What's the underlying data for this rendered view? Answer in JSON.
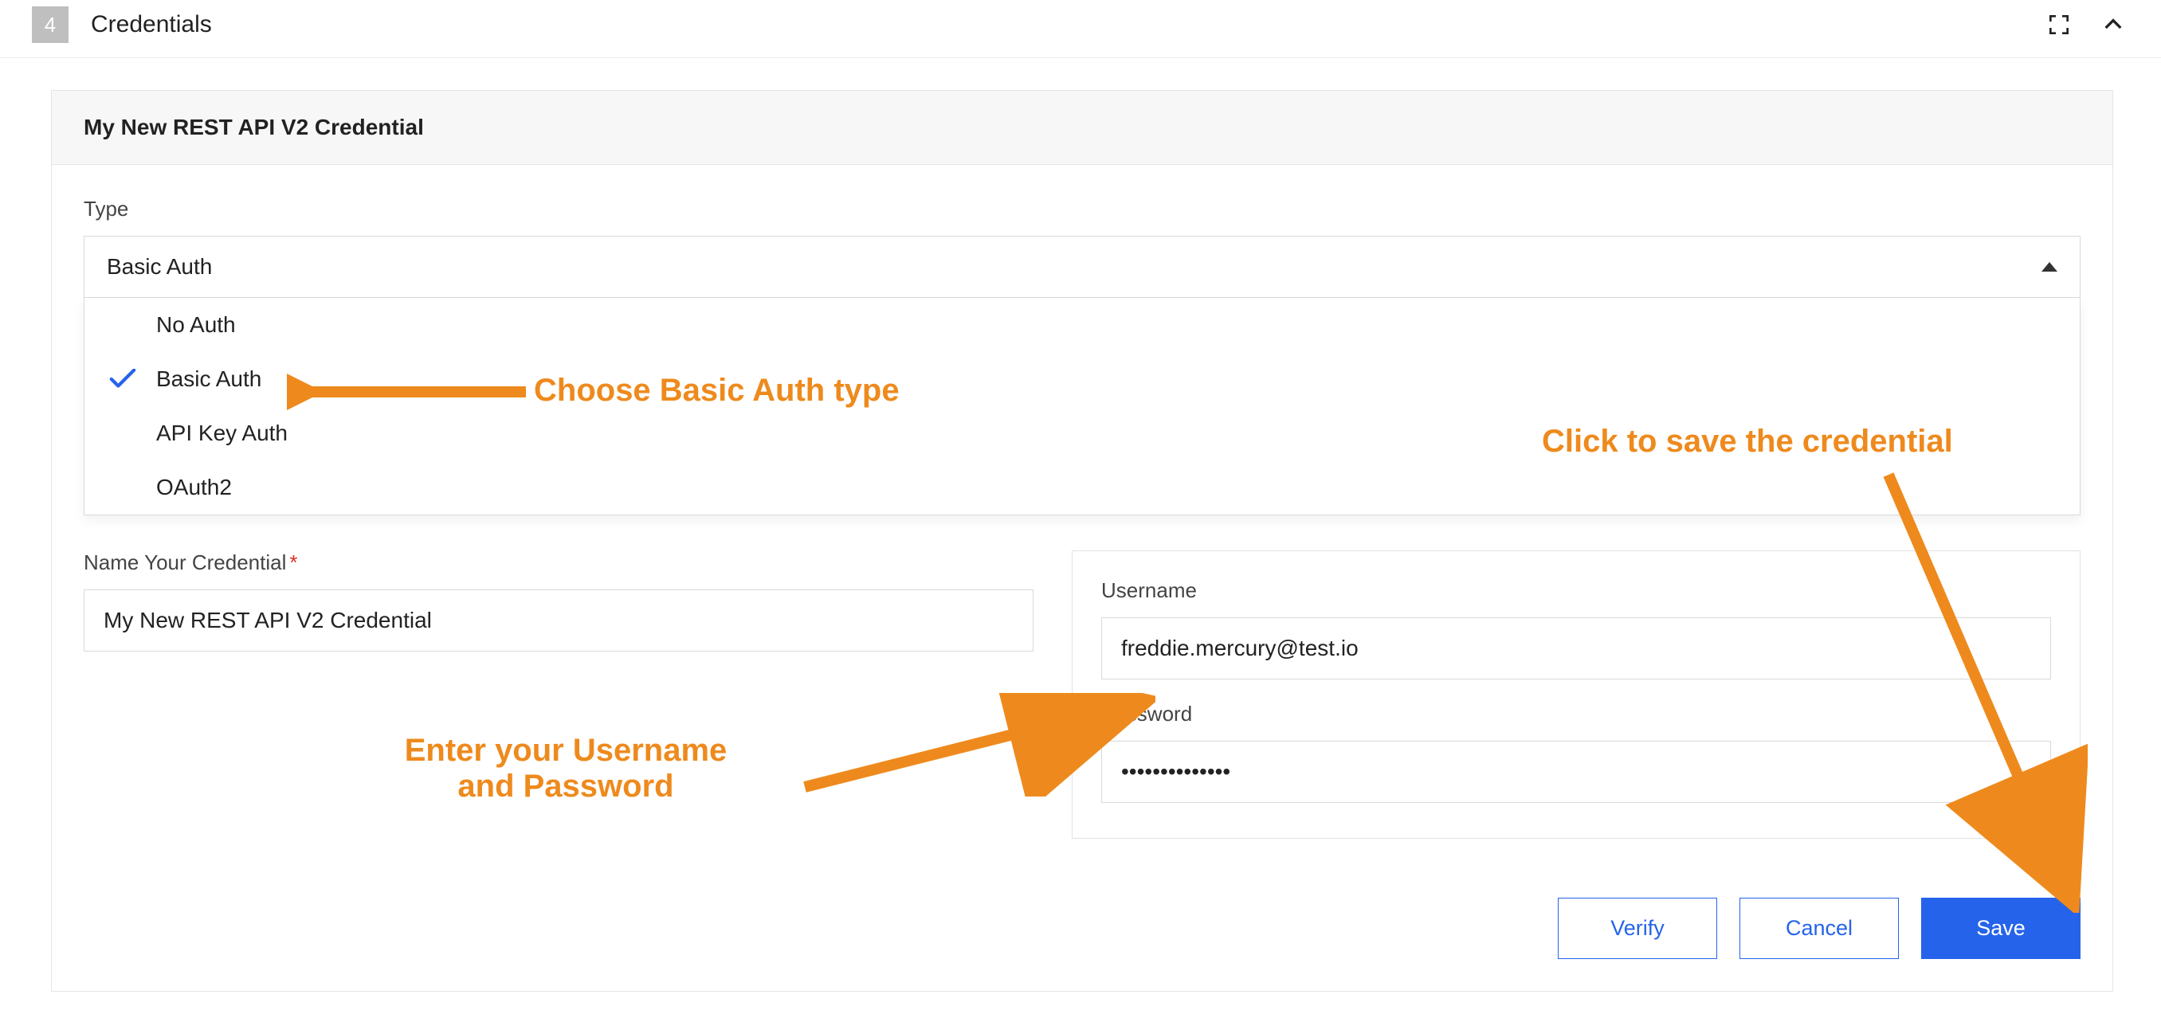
{
  "header": {
    "step_number": "4",
    "title": "Credentials"
  },
  "panel": {
    "title": "My New REST API V2 Credential"
  },
  "type_field": {
    "label": "Type",
    "selected": "Basic Auth",
    "options": [
      "No Auth",
      "Basic Auth",
      "API Key Auth",
      "OAuth2"
    ],
    "selected_index": 1
  },
  "name_field": {
    "label": "Name Your Credential",
    "value": "My New REST API V2 Credential"
  },
  "username_field": {
    "label": "Username",
    "value": "freddie.mercury@test.io"
  },
  "password_field": {
    "label": "Password",
    "value": "••••••••••••••"
  },
  "buttons": {
    "verify": "Verify",
    "cancel": "Cancel",
    "save": "Save"
  },
  "annotations": {
    "choose_type": "Choose Basic Auth type",
    "enter_creds_line1": "Enter your Username",
    "enter_creds_line2": "and Password",
    "save_hint": "Click to save the credential"
  }
}
